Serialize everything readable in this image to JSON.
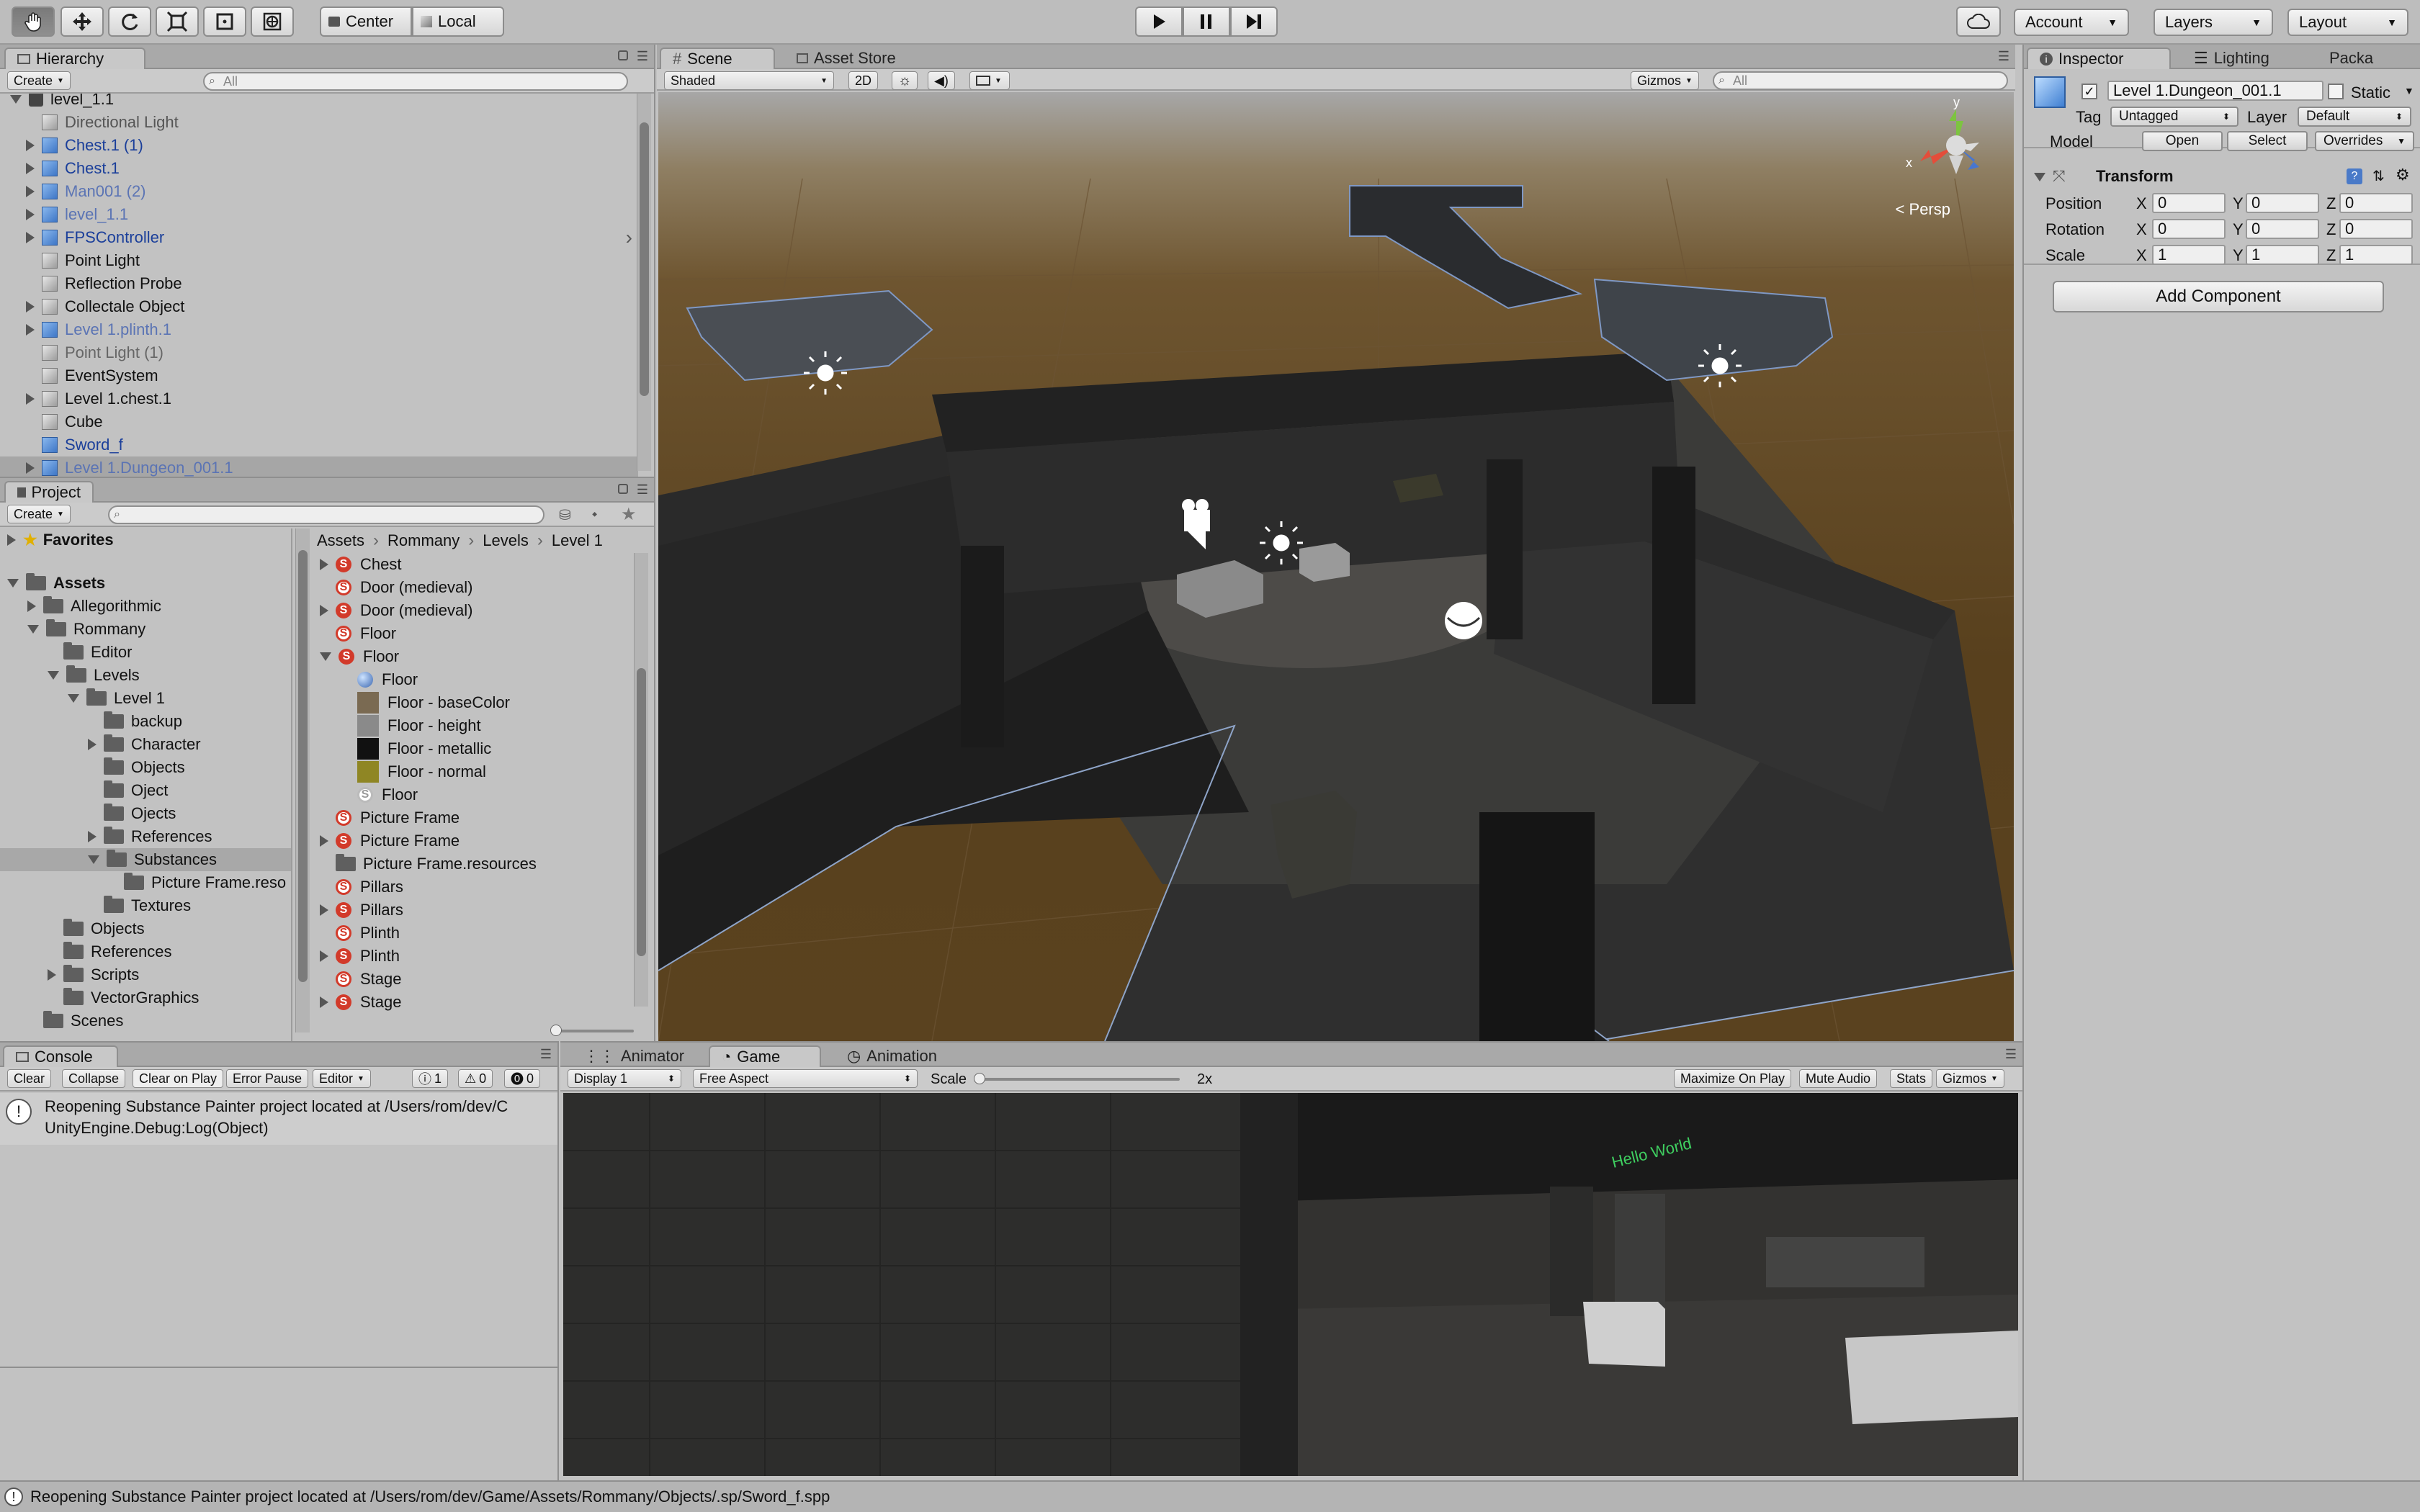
{
  "toolbar": {
    "pivot_center": "Center",
    "pivot_local": "Local",
    "account": "Account",
    "layers": "Layers",
    "layout": "Layout"
  },
  "hierarchy": {
    "tab": "Hierarchy",
    "create": "Create",
    "search_placeholder": "All",
    "scene_root": "level_1.1",
    "items": [
      {
        "label": "Directional Light",
        "color": "#555555",
        "arrow": false,
        "icon": "cube"
      },
      {
        "label": "Chest.1 (1)",
        "color": "#1b3f9a",
        "arrow": true,
        "icon": "cube-blue"
      },
      {
        "label": "Chest.1",
        "color": "#1b3f9a",
        "arrow": true,
        "icon": "cube-blue"
      },
      {
        "label": "Man001 (2)",
        "color": "#5b74b4",
        "arrow": true,
        "icon": "cube-blue"
      },
      {
        "label": "level_1.1",
        "color": "#5b74b4",
        "arrow": true,
        "icon": "cube-blue"
      },
      {
        "label": "FPSController",
        "color": "#1b3f9a",
        "arrow": true,
        "icon": "cube-blue"
      },
      {
        "label": "Point Light",
        "color": "#111111",
        "arrow": false,
        "icon": "cube"
      },
      {
        "label": "Reflection Probe",
        "color": "#111111",
        "arrow": false,
        "icon": "cube"
      },
      {
        "label": "Collectale Object",
        "color": "#111111",
        "arrow": true,
        "icon": "cube"
      },
      {
        "label": "Level 1.plinth.1",
        "color": "#5b74b4",
        "arrow": true,
        "icon": "cube-blue"
      },
      {
        "label": "Point Light (1)",
        "color": "#666666",
        "arrow": false,
        "icon": "cube"
      },
      {
        "label": "EventSystem",
        "color": "#111111",
        "arrow": false,
        "icon": "cube"
      },
      {
        "label": "Level 1.chest.1",
        "color": "#111111",
        "arrow": true,
        "icon": "cube"
      },
      {
        "label": "Cube",
        "color": "#111111",
        "arrow": false,
        "icon": "cube"
      },
      {
        "label": "Sword_f",
        "color": "#1b3f9a",
        "arrow": false,
        "icon": "cube-blue"
      },
      {
        "label": "Level 1.Dungeon_001.1",
        "color": "#5b74b4",
        "arrow": true,
        "icon": "cube-blue",
        "selected": true
      }
    ]
  },
  "project": {
    "tab": "Project",
    "create": "Create",
    "favorites": "Favorites",
    "tree": [
      {
        "label": "Assets",
        "depth": 0,
        "arrow": "down",
        "bold": true
      },
      {
        "label": "Allegorithmic",
        "depth": 1,
        "arrow": "right"
      },
      {
        "label": "Rommany",
        "depth": 1,
        "arrow": "down"
      },
      {
        "label": "Editor",
        "depth": 2,
        "arrow": "none"
      },
      {
        "label": "Levels",
        "depth": 2,
        "arrow": "down"
      },
      {
        "label": "Level 1",
        "depth": 3,
        "arrow": "down"
      },
      {
        "label": "backup",
        "depth": 4,
        "arrow": "none"
      },
      {
        "label": "Character",
        "depth": 4,
        "arrow": "right"
      },
      {
        "label": "Objects",
        "depth": 4,
        "arrow": "none"
      },
      {
        "label": "Oject",
        "depth": 4,
        "arrow": "none"
      },
      {
        "label": "Ojects",
        "depth": 4,
        "arrow": "none"
      },
      {
        "label": "References",
        "depth": 4,
        "arrow": "right"
      },
      {
        "label": "Substances",
        "depth": 4,
        "arrow": "down",
        "selected": true
      },
      {
        "label": "Picture Frame.reso",
        "depth": 5,
        "arrow": "none"
      },
      {
        "label": "Textures",
        "depth": 4,
        "arrow": "none"
      },
      {
        "label": "Objects",
        "depth": 2,
        "arrow": "none"
      },
      {
        "label": "References",
        "depth": 2,
        "arrow": "none"
      },
      {
        "label": "Scripts",
        "depth": 2,
        "arrow": "right"
      },
      {
        "label": "VectorGraphics",
        "depth": 2,
        "arrow": "none"
      },
      {
        "label": "Scenes",
        "depth": 1,
        "arrow": "none"
      }
    ],
    "breadcrumb": [
      "Assets",
      "Rommany",
      "Levels",
      "Level 1"
    ],
    "files": [
      {
        "label": "Chest",
        "icon": "substance",
        "arrow": "right",
        "indent": 0
      },
      {
        "label": "Door (medieval)",
        "icon": "substance-ring",
        "arrow": "none",
        "indent": 0
      },
      {
        "label": "Door (medieval)",
        "icon": "substance",
        "arrow": "right",
        "indent": 0
      },
      {
        "label": "Floor",
        "icon": "substance-ring",
        "arrow": "none",
        "indent": 0
      },
      {
        "label": "Floor",
        "icon": "substance",
        "arrow": "down",
        "indent": 0
      },
      {
        "label": "Floor",
        "icon": "sphere",
        "arrow": "none",
        "indent": 1
      },
      {
        "label": "Floor - baseColor",
        "icon": "tex-base",
        "arrow": "none",
        "indent": 1
      },
      {
        "label": "Floor - height",
        "icon": "tex-height",
        "arrow": "none",
        "indent": 1
      },
      {
        "label": "Floor - metallic",
        "icon": "tex-metal",
        "arrow": "none",
        "indent": 1
      },
      {
        "label": "Floor - normal",
        "icon": "tex-normal",
        "arrow": "none",
        "indent": 1
      },
      {
        "label": "Floor",
        "icon": "substance-white",
        "arrow": "none",
        "indent": 1
      },
      {
        "label": "Picture Frame",
        "icon": "substance-ring",
        "arrow": "none",
        "indent": 0
      },
      {
        "label": "Picture Frame",
        "icon": "substance",
        "arrow": "right",
        "indent": 0
      },
      {
        "label": "Picture Frame.resources",
        "icon": "folder",
        "arrow": "none",
        "indent": 0
      },
      {
        "label": "Pillars",
        "icon": "substance-ring",
        "arrow": "none",
        "indent": 0
      },
      {
        "label": "Pillars",
        "icon": "substance",
        "arrow": "right",
        "indent": 0
      },
      {
        "label": "Plinth",
        "icon": "substance-ring",
        "arrow": "none",
        "indent": 0
      },
      {
        "label": "Plinth",
        "icon": "substance",
        "arrow": "right",
        "indent": 0
      },
      {
        "label": "Stage",
        "icon": "substance-ring",
        "arrow": "none",
        "indent": 0
      },
      {
        "label": "Stage",
        "icon": "substance",
        "arrow": "right",
        "indent": 0
      }
    ]
  },
  "scene": {
    "tab_scene": "Scene",
    "tab_store": "Asset Store",
    "shading": "Shaded",
    "mode_2d": "2D",
    "gizmos": "Gizmos",
    "search_placeholder": "All",
    "persp": "Persp",
    "axis_x": "x",
    "axis_y": "y"
  },
  "inspector": {
    "tab": "Inspector",
    "tab_lighting": "Lighting",
    "tab_pack": "Packa",
    "object_name": "Level 1.Dungeon_001.1",
    "static_label": "Static",
    "tag_label": "Tag",
    "tag_value": "Untagged",
    "layer_label": "Layer",
    "layer_value": "Default",
    "model_label": "Model",
    "open": "Open",
    "select": "Select",
    "overrides": "Overrides",
    "transform_title": "Transform",
    "position_label": "Position",
    "rotation_label": "Rotation",
    "scale_label": "Scale",
    "position": {
      "x": "0",
      "y": "0",
      "z": "0"
    },
    "rotation": {
      "x": "0",
      "y": "0",
      "z": "0"
    },
    "scale": {
      "x": "1",
      "y": "1",
      "z": "1"
    },
    "axis_x": "X",
    "axis_y": "Y",
    "axis_z": "Z",
    "add_component": "Add Component"
  },
  "console": {
    "tab": "Console",
    "clear": "Clear",
    "collapse": "Collapse",
    "clear_on_play": "Clear on Play",
    "error_pause": "Error Pause",
    "editor": "Editor",
    "count_info": "1",
    "count_warn": "0",
    "count_error": "0",
    "message_line1": "Reopening Substance Painter project located at /Users/rom/dev/C",
    "message_line2": "UnityEngine.Debug:Log(Object)"
  },
  "game": {
    "tab_animator": "Animator",
    "tab_game": "Game",
    "tab_animation": "Animation",
    "display": "Display 1",
    "aspect": "Free Aspect",
    "scale_label": "Scale",
    "scale_value": "2x",
    "maximize": "Maximize On Play",
    "mute": "Mute Audio",
    "stats": "Stats",
    "gizmos": "Gizmos",
    "sign_text": "Hello World"
  },
  "status_bar": {
    "message": "Reopening Substance Painter project located at /Users/rom/dev/Game/Assets/Rommany/Objects/.sp/Sword_f.spp"
  }
}
